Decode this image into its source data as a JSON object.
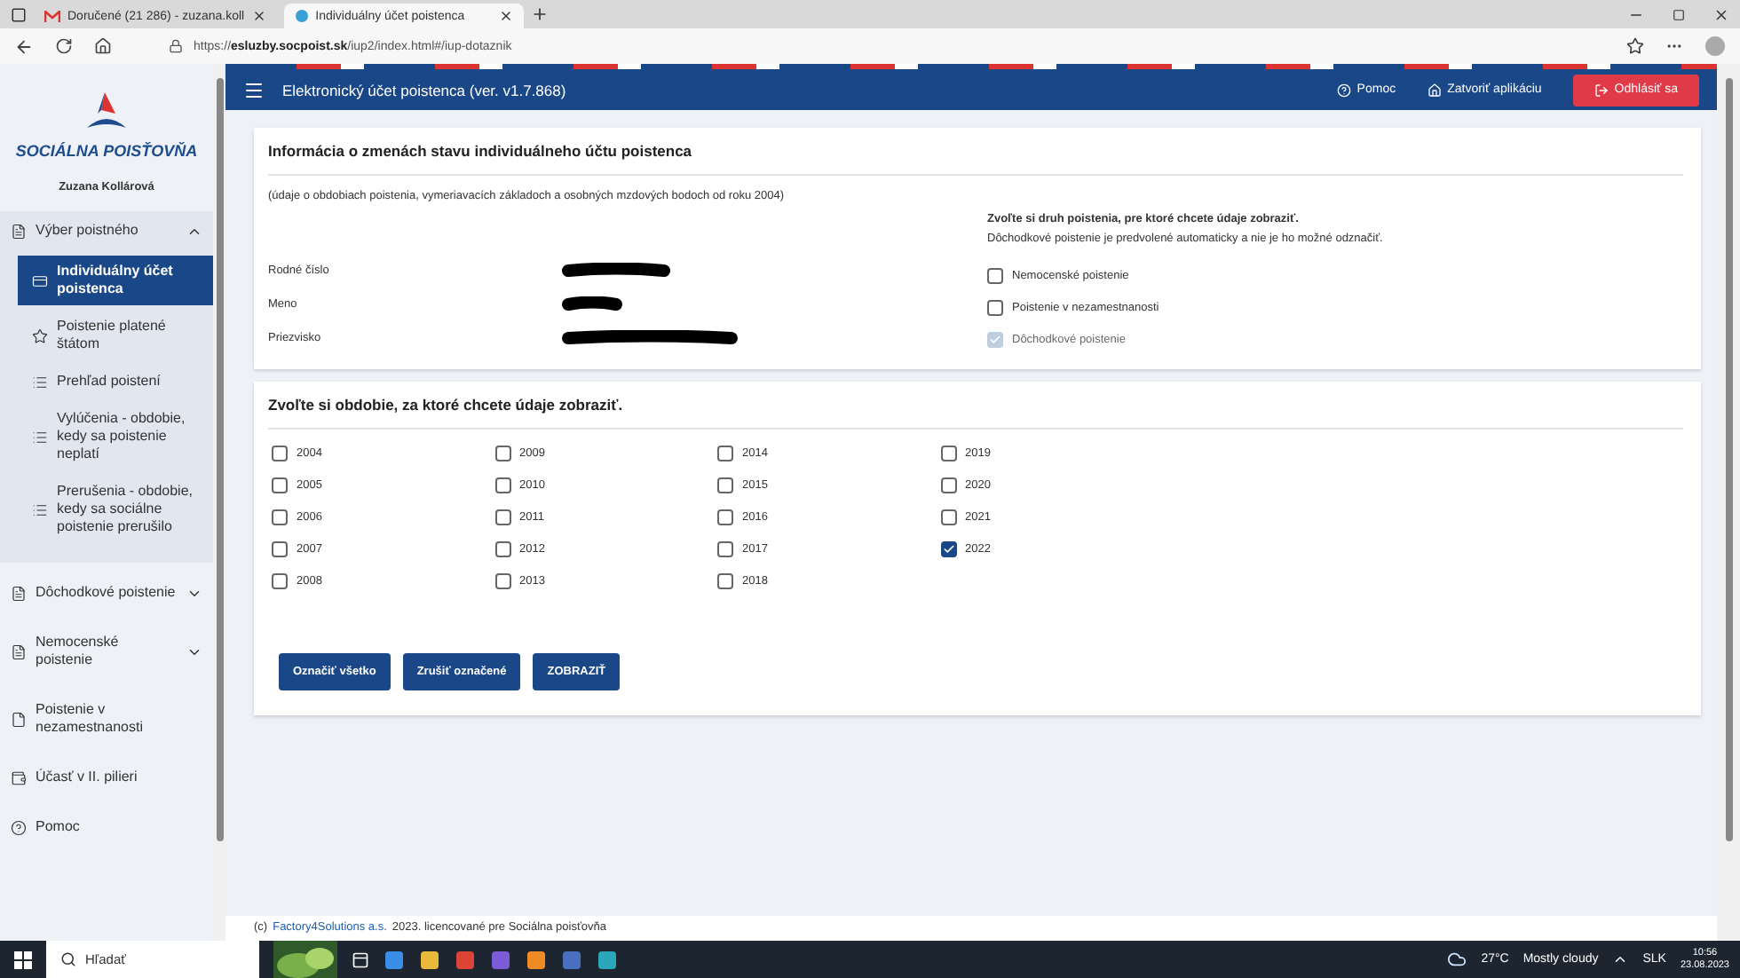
{
  "browser": {
    "tabs": [
      {
        "title": "Doručené (21 286) - zuzana.koll",
        "selected": false,
        "kind": "mail"
      },
      {
        "title": "Individuálny účet poistenca",
        "selected": true,
        "kind": "site"
      }
    ],
    "url_prefix": "https://",
    "url_host": "esluzby.socpoist.sk",
    "url_path": "/iup2/index.html#/iup-dotaznik"
  },
  "header": {
    "title": "Elektronický účet poistenca (ver. v1.7.868)",
    "help": "Pomoc",
    "close": "Zatvoriť aplikáciu",
    "logout": "Odhlásiť sa"
  },
  "sidebar": {
    "brand": "SOCIÁLNA POISŤOVŇA",
    "user": "Zuzana Kollárová",
    "items": [
      {
        "label": "Výber poistného",
        "kind": "doc",
        "expanded": true,
        "children": [
          {
            "label": "Individuálny účet poistenca",
            "kind": "card",
            "selected": true
          },
          {
            "label": "Poistenie platené štátom",
            "kind": "star",
            "selected": false
          },
          {
            "label": "Prehľad poistení",
            "kind": "list",
            "selected": false
          },
          {
            "label": "Vylúčenia - obdobie, kedy sa poistenie neplatí",
            "kind": "list",
            "selected": false
          },
          {
            "label": "Prerušenia - obdobie, kedy sa sociálne poistenie prerušilo",
            "kind": "list",
            "selected": false
          }
        ]
      },
      {
        "label": "Dôchodkové poistenie",
        "kind": "doc",
        "expanded": false
      },
      {
        "label": "Nemocenské poistenie",
        "kind": "doc",
        "expanded": false
      },
      {
        "label": "Poistenie v nezamestnanosti",
        "kind": "page"
      },
      {
        "label": "Účasť v II. pilieri",
        "kind": "wallet"
      },
      {
        "label": "Pomoc",
        "kind": "help"
      }
    ]
  },
  "info_card": {
    "title": "Informácia o zmenách stavu individuálneho účtu poistenca",
    "note": "(údaje o obdobiach poistenia, vymeriavacích základoch a osobných mzdových bodoch od roku 2004)",
    "fields": [
      {
        "label": "Rodné číslo"
      },
      {
        "label": "Meno"
      },
      {
        "label": "Priezvisko"
      }
    ],
    "prompt": "Zvoľte si druh poistenia, pre ktoré chcete údaje zobraziť.",
    "hint": "Dôchodkové poistenie je predvolené automaticky a nie je ho možné odznačiť.",
    "options": [
      {
        "label": "Nemocenské poistenie",
        "checked": false,
        "disabled": false
      },
      {
        "label": "Poistenie v nezamestnanosti",
        "checked": false,
        "disabled": false
      },
      {
        "label": "Dôchodkové poistenie",
        "checked": true,
        "disabled": true
      }
    ]
  },
  "period_card": {
    "title": "Zvoľte si obdobie, za ktoré chcete údaje zobraziť.",
    "years": [
      {
        "label": "2004",
        "checked": false
      },
      {
        "label": "2005",
        "checked": false
      },
      {
        "label": "2006",
        "checked": false
      },
      {
        "label": "2007",
        "checked": false
      },
      {
        "label": "2008",
        "checked": false
      },
      {
        "label": "2009",
        "checked": false
      },
      {
        "label": "2010",
        "checked": false
      },
      {
        "label": "2011",
        "checked": false
      },
      {
        "label": "2012",
        "checked": false
      },
      {
        "label": "2013",
        "checked": false
      },
      {
        "label": "2014",
        "checked": false
      },
      {
        "label": "2015",
        "checked": false
      },
      {
        "label": "2016",
        "checked": false
      },
      {
        "label": "2017",
        "checked": false
      },
      {
        "label": "2018",
        "checked": false
      },
      {
        "label": "2019",
        "checked": false
      },
      {
        "label": "2020",
        "checked": false
      },
      {
        "label": "2021",
        "checked": false
      },
      {
        "label": "2022",
        "checked": true
      }
    ],
    "buttons": [
      "Označiť všetko",
      "Zrušiť označené",
      "ZOBRAZIŤ"
    ]
  },
  "footer": {
    "prefix": "(c)",
    "link": "Factory4Solutions a.s.",
    "text": "2023.  licencované pre Sociálna poisťovňa"
  },
  "taskbar": {
    "search": "Hľadať",
    "temperature": "27°C",
    "weather": "Mostly cloudy",
    "language": "SLK",
    "time": "10:56",
    "date": "23.08.2023"
  }
}
